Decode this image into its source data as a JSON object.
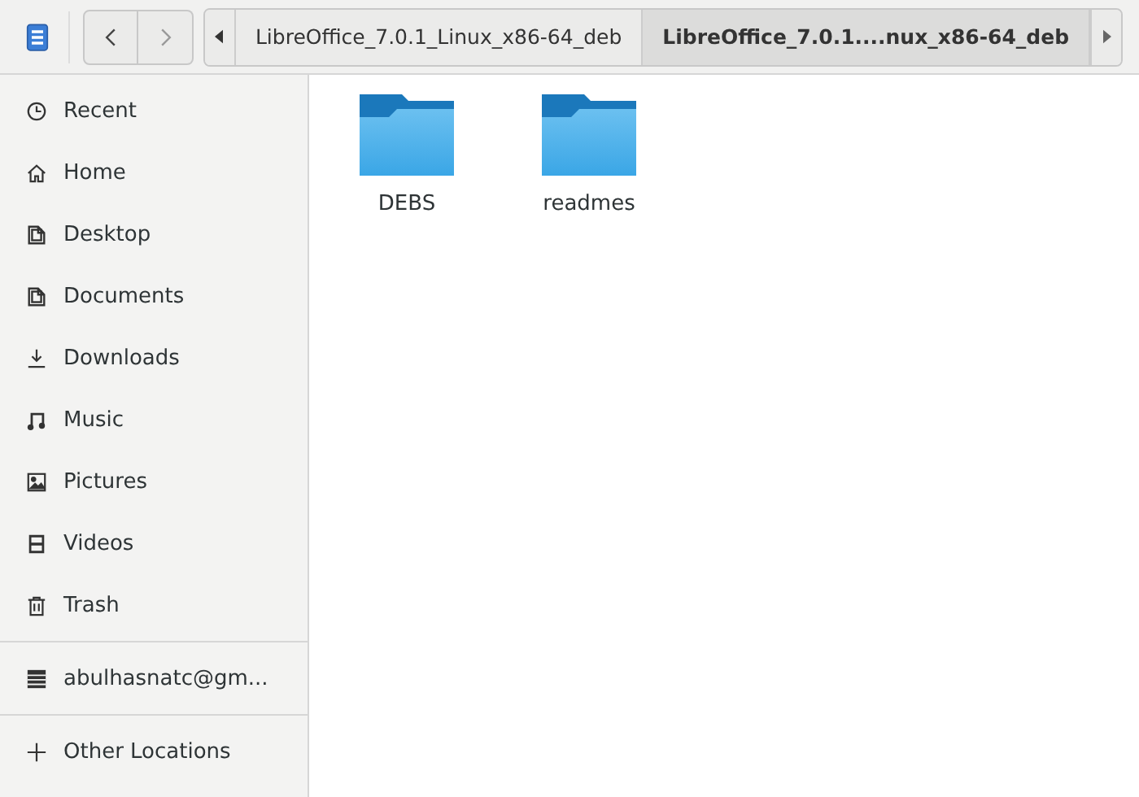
{
  "breadcrumbs": [
    {
      "label": "LibreOffice_7.0.1_Linux_x86-64_deb",
      "selected": false
    },
    {
      "label": "LibreOffice_7.0.1....nux_x86-64_deb",
      "selected": true
    }
  ],
  "sidebar": {
    "places": [
      {
        "label": "Recent",
        "kind": "recent"
      },
      {
        "label": "Home",
        "kind": "home"
      },
      {
        "label": "Desktop",
        "kind": "folder"
      },
      {
        "label": "Documents",
        "kind": "folder"
      },
      {
        "label": "Downloads",
        "kind": "download"
      },
      {
        "label": "Music",
        "kind": "music"
      },
      {
        "label": "Pictures",
        "kind": "pictures"
      },
      {
        "label": "Videos",
        "kind": "videos"
      },
      {
        "label": "Trash",
        "kind": "trash"
      }
    ],
    "drives": [
      {
        "label": "abulhasnatc@gm...",
        "kind": "drive"
      }
    ],
    "other": [
      {
        "label": "Other Locations",
        "kind": "plus"
      }
    ]
  },
  "files": [
    {
      "name": "DEBS"
    },
    {
      "name": "readmes"
    }
  ]
}
